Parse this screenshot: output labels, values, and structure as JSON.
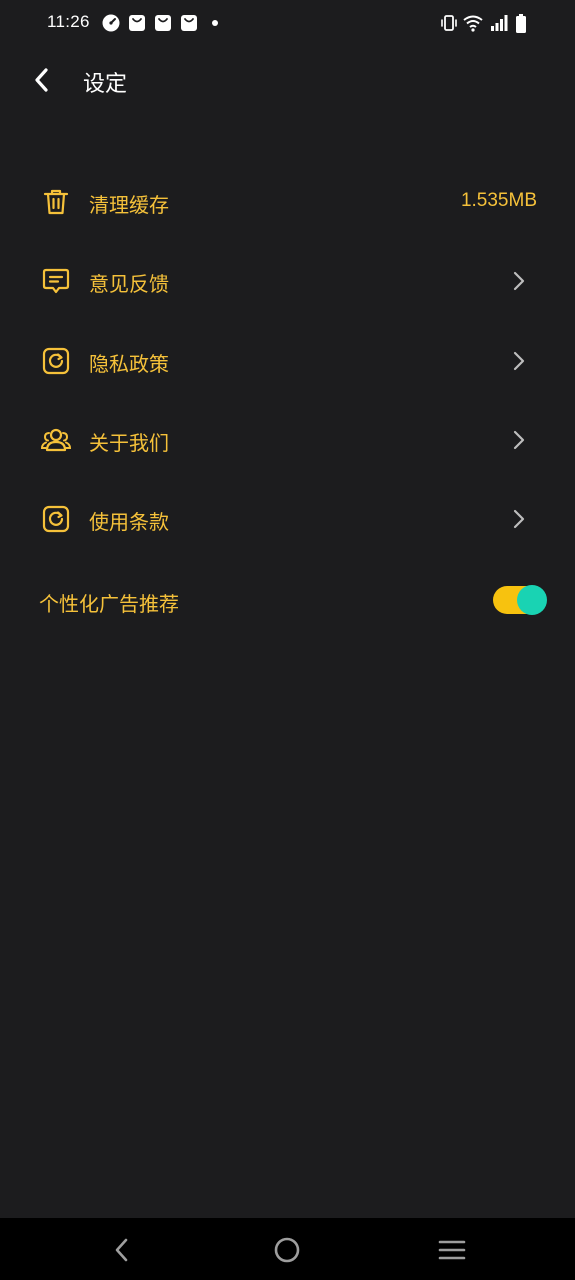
{
  "status_bar": {
    "time": "11:26"
  },
  "header": {
    "title": "设定"
  },
  "settings": {
    "items": [
      {
        "label": "清理缓存",
        "value": "1.535MB",
        "icon": "trash-icon"
      },
      {
        "label": "意见反馈",
        "icon": "feedback-icon"
      },
      {
        "label": "隐私政策",
        "icon": "privacy-icon"
      },
      {
        "label": "关于我们",
        "icon": "users-icon"
      },
      {
        "label": "使用条款",
        "icon": "terms-icon"
      }
    ],
    "ad_toggle": {
      "label": "个性化广告推荐",
      "enabled": true
    }
  },
  "colors": {
    "background": "#1c1c1e",
    "accent": "#f5c13a",
    "toggle_track": "#f7c20f",
    "toggle_knob": "#19d3b3",
    "nav_bar": "#000000"
  }
}
